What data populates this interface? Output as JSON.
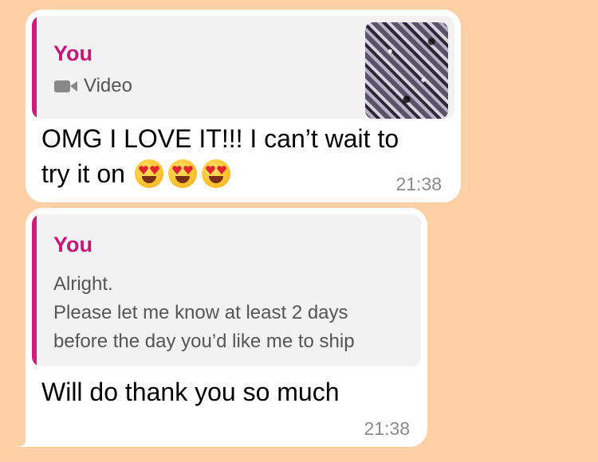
{
  "messages": [
    {
      "quote": {
        "sender": "You",
        "type_label": "Video",
        "type_icon": "video-camera-icon"
      },
      "text_line1": "OMG I LOVE IT!!! I can’t wait to",
      "text_line2": "try it on",
      "emoji": [
        "heart-eyes-emoji",
        "heart-eyes-emoji",
        "heart-eyes-emoji"
      ],
      "time": "21:38"
    },
    {
      "quote": {
        "sender": "You",
        "line1": "Alright.",
        "line2": "Please let me know at least 2 days",
        "line3": "before the day you’d like me to ship"
      },
      "text": "Will do thank you so much",
      "time": "21:38"
    }
  ],
  "colors": {
    "background": "#FFD0A5",
    "bubble": "#FFFFFF",
    "quote_background": "#F2F2F2",
    "accent": "#D4197A",
    "timestamp": "#8A8A8A"
  }
}
